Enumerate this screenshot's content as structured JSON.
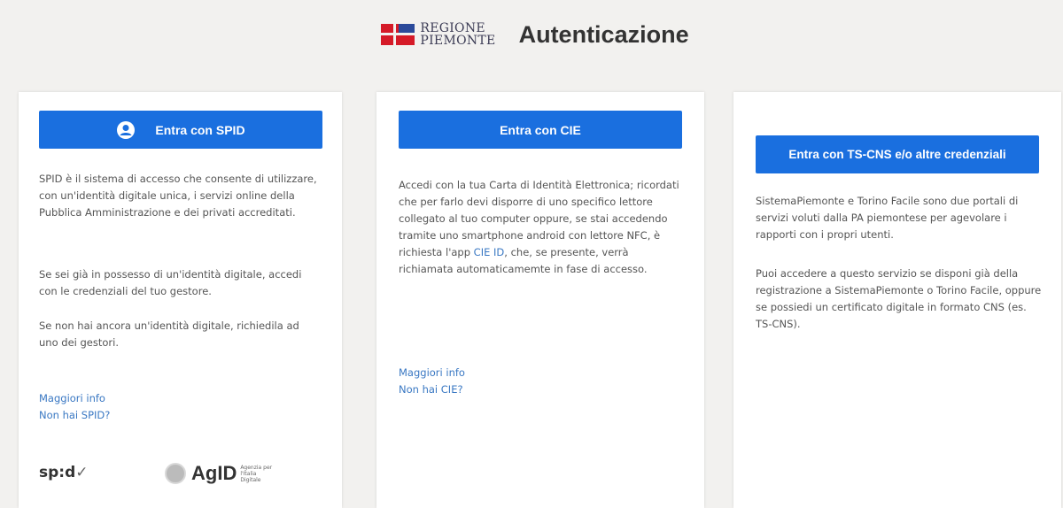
{
  "header": {
    "logo_line1": "REGIONE",
    "logo_line2": "PIEMONTE",
    "title": "Autenticazione"
  },
  "spid": {
    "button_label": "Entra con SPID",
    "icon": "user-circle-icon",
    "p1": "SPID è il sistema di accesso che consente di utilizzare, con un'identità digitale unica, i servizi online della Pubblica Amministrazione e dei privati accreditati.",
    "p2": "Se sei già in possesso di un'identità digitale, accedi con le credenziali del tuo gestore.",
    "p3": "Se non hai ancora un'identità digitale, richiedila ad uno dei gestori.",
    "link_more": "Maggiori info",
    "link_no": "Non hai SPID?",
    "logo_spid": "sp:d",
    "logo_spid_tick": "✓",
    "logo_agid": "AgID",
    "logo_agid_sub": "Agenzia per l'Italia Digitale"
  },
  "cie": {
    "button_label": "Entra con CIE",
    "p1_before": "Accedi con la tua Carta di Identità Elettronica; ricordati che per farlo devi disporre di uno specifico lettore collegato al tuo computer oppure, se stai accedendo tramite uno smartphone android con lettore NFC, è richiesta l'app ",
    "p1_link": "CIE ID",
    "p1_after": ", che, se presente, verrà richiamata automaticamemte in fase di accesso.",
    "link_more": "Maggiori info",
    "link_no": "Non hai CIE?"
  },
  "ts": {
    "button_label": "Entra con TS-CNS e/o altre credenziali",
    "p1": "SistemaPiemonte e Torino Facile sono due portali di servizi voluti dalla PA piemontese per agevolare i rapporti con i propri utenti.",
    "p2": "Puoi accedere a questo servizio se disponi già della registrazione a SistemaPiemonte o Torino Facile, oppure se possiedi un certificato digitale in formato CNS (es. TS-CNS)."
  },
  "colors": {
    "primary": "#1a6fdf",
    "link": "#3a78c3",
    "background": "#f2f1ef"
  }
}
